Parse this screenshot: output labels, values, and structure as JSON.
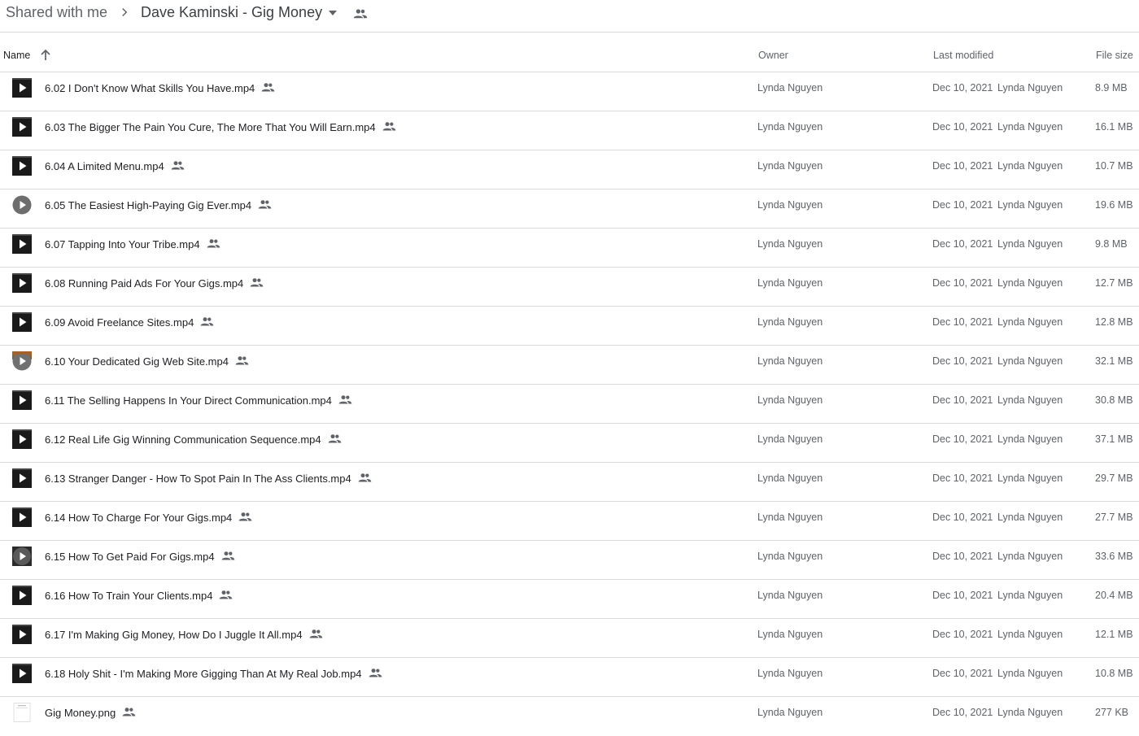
{
  "breadcrumb": {
    "root": "Shared with me",
    "current": "Dave Kaminski - Gig Money"
  },
  "columns": {
    "name": "Name",
    "owner": "Owner",
    "last_modified": "Last modified",
    "file_size": "File size"
  },
  "files": [
    {
      "name": "6.02 I Don't Know What Skills You Have.mp4",
      "owner": "Lynda Nguyen",
      "modified_date": "Dec 10, 2021",
      "modified_by": "Lynda Nguyen",
      "size": "8.9 MB",
      "thumb": "video"
    },
    {
      "name": "6.03 The Bigger The Pain You Cure, The More That You Will Earn.mp4",
      "owner": "Lynda Nguyen",
      "modified_date": "Dec 10, 2021",
      "modified_by": "Lynda Nguyen",
      "size": "16.1 MB",
      "thumb": "video"
    },
    {
      "name": "6.04 A Limited Menu.mp4",
      "owner": "Lynda Nguyen",
      "modified_date": "Dec 10, 2021",
      "modified_by": "Lynda Nguyen",
      "size": "10.7 MB",
      "thumb": "video"
    },
    {
      "name": "6.05 The Easiest High-Paying Gig Ever.mp4",
      "owner": "Lynda Nguyen",
      "modified_date": "Dec 10, 2021",
      "modified_by": "Lynda Nguyen",
      "size": "19.6 MB",
      "thumb": "video-round"
    },
    {
      "name": "6.07 Tapping Into Your Tribe.mp4",
      "owner": "Lynda Nguyen",
      "modified_date": "Dec 10, 2021",
      "modified_by": "Lynda Nguyen",
      "size": "9.8 MB",
      "thumb": "video"
    },
    {
      "name": "6.08 Running Paid Ads For Your Gigs.mp4",
      "owner": "Lynda Nguyen",
      "modified_date": "Dec 10, 2021",
      "modified_by": "Lynda Nguyen",
      "size": "12.7 MB",
      "thumb": "video"
    },
    {
      "name": "6.09 Avoid Freelance Sites.mp4",
      "owner": "Lynda Nguyen",
      "modified_date": "Dec 10, 2021",
      "modified_by": "Lynda Nguyen",
      "size": "12.8 MB",
      "thumb": "video"
    },
    {
      "name": "6.10 Your Dedicated Gig Web Site.mp4",
      "owner": "Lynda Nguyen",
      "modified_date": "Dec 10, 2021",
      "modified_by": "Lynda Nguyen",
      "size": "32.1 MB",
      "thumb": "video-photo"
    },
    {
      "name": "6.11 The Selling Happens In Your Direct Communication.mp4",
      "owner": "Lynda Nguyen",
      "modified_date": "Dec 10, 2021",
      "modified_by": "Lynda Nguyen",
      "size": "30.8 MB",
      "thumb": "video"
    },
    {
      "name": "6.12 Real Life Gig Winning Communication Sequence.mp4",
      "owner": "Lynda Nguyen",
      "modified_date": "Dec 10, 2021",
      "modified_by": "Lynda Nguyen",
      "size": "37.1 MB",
      "thumb": "video"
    },
    {
      "name": "6.13 Stranger Danger - How To Spot Pain In The Ass Clients.mp4",
      "owner": "Lynda Nguyen",
      "modified_date": "Dec 10, 2021",
      "modified_by": "Lynda Nguyen",
      "size": "29.7 MB",
      "thumb": "video"
    },
    {
      "name": "6.14 How To Charge For Your Gigs.mp4",
      "owner": "Lynda Nguyen",
      "modified_date": "Dec 10, 2021",
      "modified_by": "Lynda Nguyen",
      "size": "27.7 MB",
      "thumb": "video"
    },
    {
      "name": "6.15 How To Get Paid For Gigs.mp4",
      "owner": "Lynda Nguyen",
      "modified_date": "Dec 10, 2021",
      "modified_by": "Lynda Nguyen",
      "size": "33.6 MB",
      "thumb": "video-grey"
    },
    {
      "name": "6.16 How To Train Your Clients.mp4",
      "owner": "Lynda Nguyen",
      "modified_date": "Dec 10, 2021",
      "modified_by": "Lynda Nguyen",
      "size": "20.4 MB",
      "thumb": "video"
    },
    {
      "name": "6.17 I'm Making Gig Money, How Do I Juggle It All.mp4",
      "owner": "Lynda Nguyen",
      "modified_date": "Dec 10, 2021",
      "modified_by": "Lynda Nguyen",
      "size": "12.1 MB",
      "thumb": "video"
    },
    {
      "name": "6.18 Holy Shit - I'm Making More Gigging Than At My Real Job.mp4",
      "owner": "Lynda Nguyen",
      "modified_date": "Dec 10, 2021",
      "modified_by": "Lynda Nguyen",
      "size": "10.8 MB",
      "thumb": "video"
    },
    {
      "name": "Gig Money.png",
      "owner": "Lynda Nguyen",
      "modified_date": "Dec 10, 2021",
      "modified_by": "Lynda Nguyen",
      "size": "277 KB",
      "thumb": "image"
    }
  ],
  "colors": {
    "text_primary": "#202124",
    "text_secondary": "#5f6368",
    "divider": "#dadce0",
    "background": "#ffffff"
  },
  "icons": {
    "breadcrumb_separator": "chevron-right-icon",
    "breadcrumb_dropdown": "caret-down-icon",
    "shared_folder": "people-icon",
    "sort": "arrow-up-icon",
    "row_shared": "people-icon",
    "video_thumb": "play-icon",
    "image_thumb": "image-file-icon"
  }
}
